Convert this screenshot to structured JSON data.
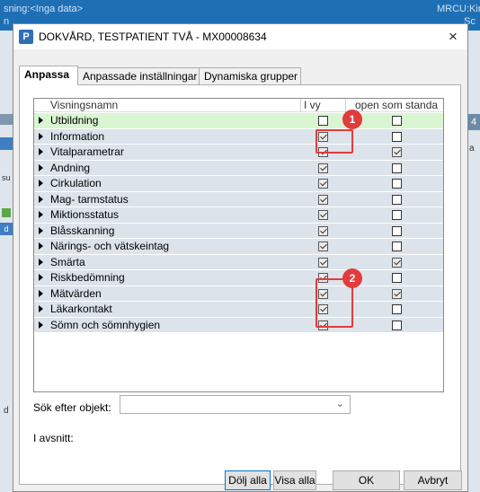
{
  "background": {
    "top_left_line1": "sning:<Inga data>",
    "top_left_line2": "n",
    "top_right_line1": "MRCU:Kirurg-",
    "top_right_line2": "Sc",
    "right_tab": "4",
    "right_text": "a",
    "left_text_su": "su",
    "left_text_d1": "d",
    "left_text_d2": "d"
  },
  "dialog": {
    "app_icon": "P",
    "title": "DOKVÅRD, TESTPATIENT TVÅ - MX00008634",
    "close_icon": "×"
  },
  "tabs": [
    {
      "label": "Anpassa",
      "active": true
    },
    {
      "label": "Anpassade inställningar",
      "active": false
    },
    {
      "label": "Dynamiska grupper",
      "active": false
    }
  ],
  "list": {
    "columns": [
      "Visningsnamn",
      "I vy",
      "open som standa"
    ],
    "rows": [
      {
        "name": "Utbildning",
        "in_view": false,
        "open_default": false,
        "selected": true
      },
      {
        "name": "Information",
        "in_view": true,
        "open_default": false
      },
      {
        "name": "Vitalparametrar",
        "in_view": true,
        "open_default": true
      },
      {
        "name": "Andning",
        "in_view": true,
        "open_default": false
      },
      {
        "name": "Cirkulation",
        "in_view": true,
        "open_default": false
      },
      {
        "name": "Mag- tarmstatus",
        "in_view": true,
        "open_default": false
      },
      {
        "name": "Miktionsstatus",
        "in_view": true,
        "open_default": false
      },
      {
        "name": "Blåsskanning",
        "in_view": true,
        "open_default": false
      },
      {
        "name": "Närings- och vätskeintag",
        "in_view": true,
        "open_default": false
      },
      {
        "name": "Smärta",
        "in_view": true,
        "open_default": true
      },
      {
        "name": "Riskbedömning",
        "in_view": true,
        "open_default": false
      },
      {
        "name": "Mätvärden",
        "in_view": true,
        "open_default": true
      },
      {
        "name": "Läkarkontakt",
        "in_view": true,
        "open_default": false
      },
      {
        "name": "Sömn och sömnhygien",
        "in_view": true,
        "open_default": false
      }
    ]
  },
  "search": {
    "label": "Sök efter objekt:",
    "value": "",
    "chevron_icon": "chevron-down-icon"
  },
  "section_label": "I avsnitt:",
  "buttons": {
    "hide_all": "Dölj alla",
    "show_all": "Visa alla",
    "ok": "OK",
    "cancel": "Avbryt"
  },
  "annotations": {
    "badge1": "1",
    "badge2": "2",
    "color": "#e23b3b"
  }
}
